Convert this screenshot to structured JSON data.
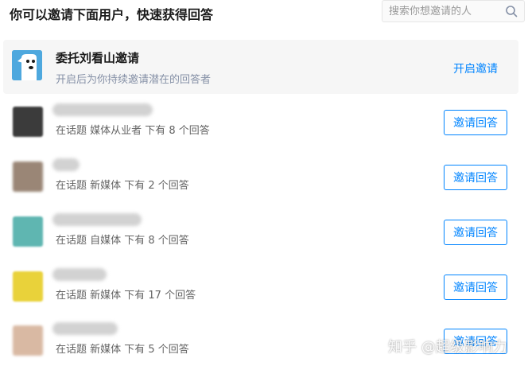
{
  "header": {
    "title": "你可以邀请下面用户，快速获得回答",
    "search_placeholder": "搜索你想邀请的人"
  },
  "featured": {
    "title": "委托刘看山邀请",
    "description": "开启后为你持续邀请潜在的回答者",
    "action": "开启邀请"
  },
  "users": [
    {
      "topic": "在话题 媒体从业者 下有 8 个回答",
      "button": "邀请回答"
    },
    {
      "topic": "在话题 新媒体 下有 2 个回答",
      "button": "邀请回答"
    },
    {
      "topic": "在话题 自媒体 下有 8 个回答",
      "button": "邀请回答"
    },
    {
      "topic": "在话题 新媒体 下有 17 个回答",
      "button": "邀请回答"
    },
    {
      "topic": "在话题 新媒体 下有 5 个回答",
      "button": "邀请回答"
    }
  ],
  "watermark": "知乎 @超级影响力",
  "colors": {
    "accent": "#0084ff",
    "muted": "#8590a6",
    "featured_bg": "#f6f6f6",
    "logo_bg": "#4ea8de"
  }
}
